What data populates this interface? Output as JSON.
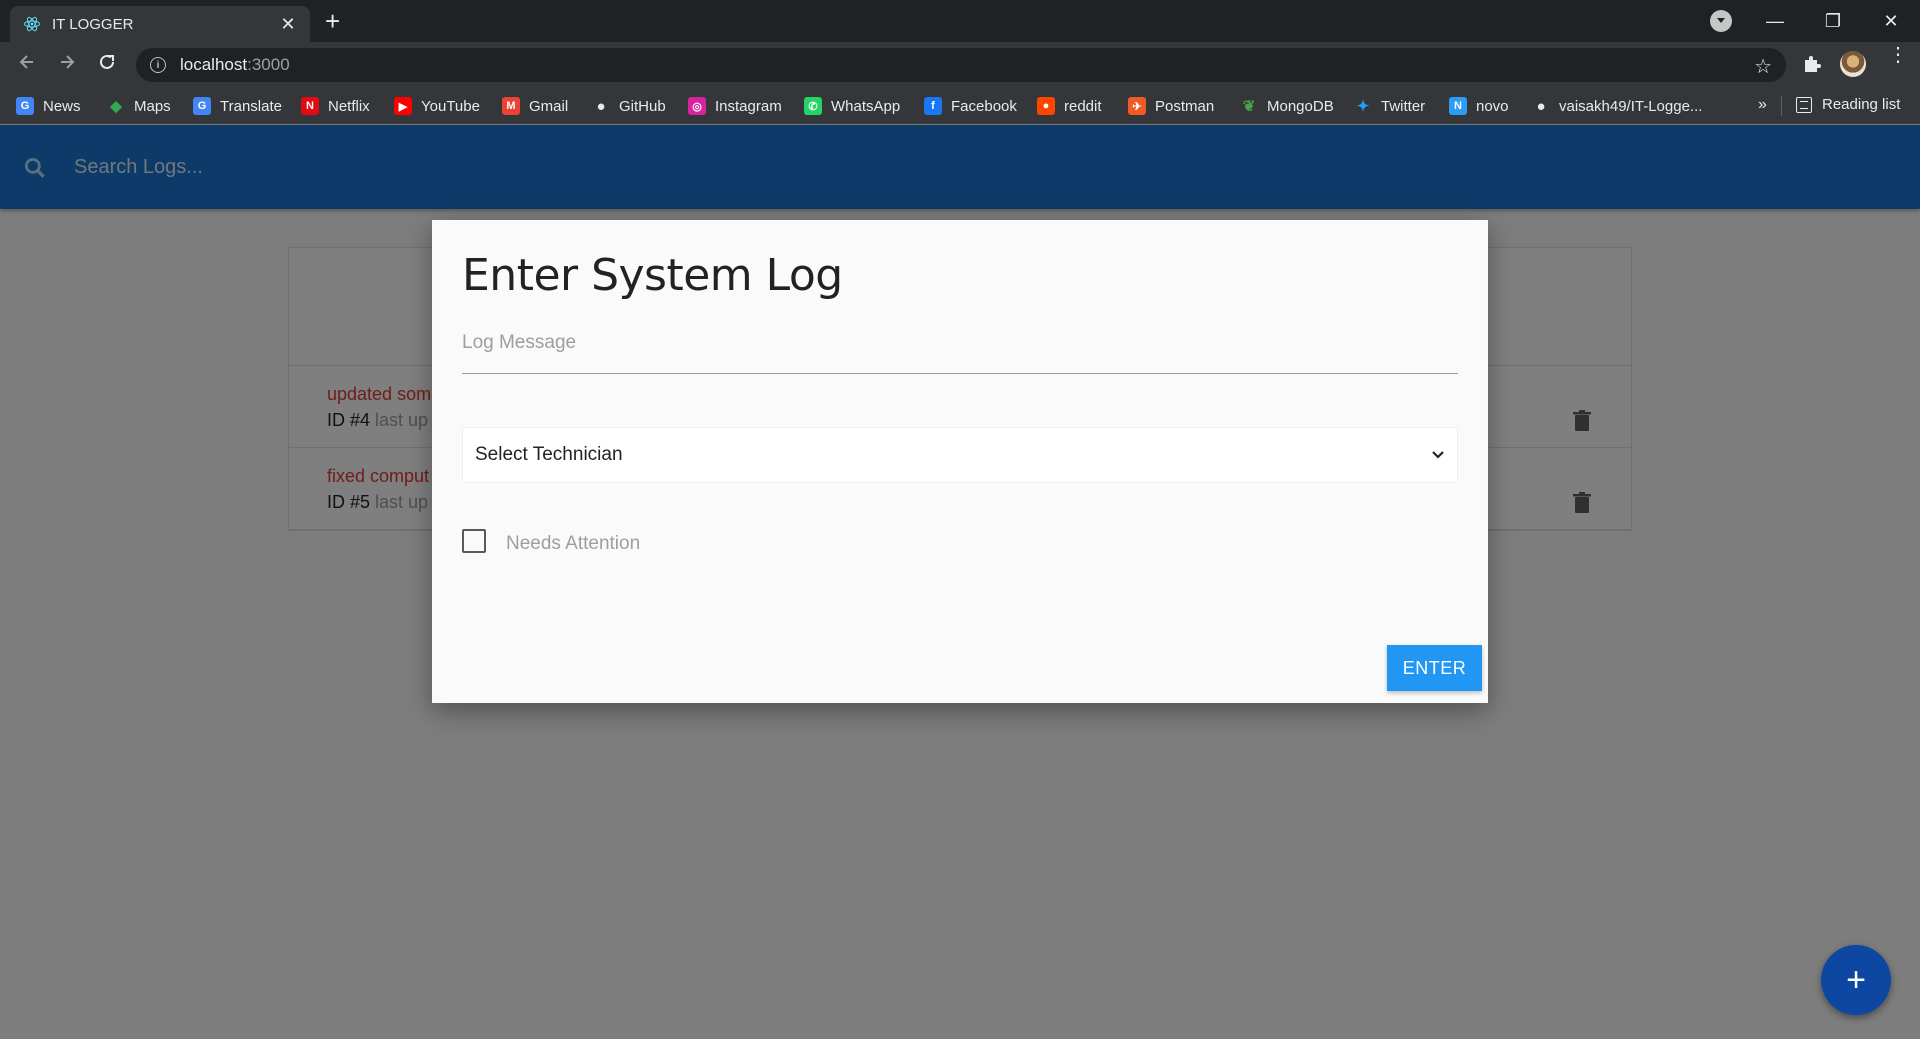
{
  "browser": {
    "tab_title": "IT LOGGER",
    "tab_close": "✕",
    "new_tab": "+",
    "url_host": "localhost",
    "url_port": ":3000",
    "window_controls": [
      "—",
      "❐",
      "✕"
    ],
    "bookmarks": [
      {
        "label": "News",
        "icon": "news-icon",
        "color": "#4285f4"
      },
      {
        "label": "Maps",
        "icon": "maps-icon",
        "color": "#34a853"
      },
      {
        "label": "Translate",
        "icon": "translate-icon",
        "color": "#4285f4"
      },
      {
        "label": "Netflix",
        "icon": "netflix-icon",
        "color": "#e50914"
      },
      {
        "label": "YouTube",
        "icon": "youtube-icon",
        "color": "#ff0000"
      },
      {
        "label": "Gmail",
        "icon": "gmail-icon",
        "color": "#ea4335"
      },
      {
        "label": "GitHub",
        "icon": "github-icon",
        "color": "#e8eaed"
      },
      {
        "label": "Instagram",
        "icon": "instagram-icon",
        "color": "#d6249f"
      },
      {
        "label": "WhatsApp",
        "icon": "whatsapp-icon",
        "color": "#25d366"
      },
      {
        "label": "Facebook",
        "icon": "facebook-icon",
        "color": "#1877f2"
      },
      {
        "label": "reddit",
        "icon": "reddit-icon",
        "color": "#ff4500"
      },
      {
        "label": "Postman",
        "icon": "postman-icon",
        "color": "#ef5b25"
      },
      {
        "label": "MongoDB",
        "icon": "mongodb-icon",
        "color": "#47a248"
      },
      {
        "label": "Twitter",
        "icon": "twitter-icon",
        "color": "#1da1f2"
      },
      {
        "label": "novo",
        "icon": "novo-icon",
        "color": "#2a9df4"
      },
      {
        "label": "vaisakh49/IT-Logge...",
        "icon": "github-icon",
        "color": "#e8eaed"
      }
    ],
    "more": "»",
    "reading_list": "Reading list"
  },
  "app": {
    "search_placeholder": "Search Logs...",
    "accent": "#1976d2",
    "logs": [
      {
        "message": "updated som",
        "id_label": "ID #4",
        "meta": " last up"
      },
      {
        "message": "fixed comput",
        "id_label": "ID #5",
        "meta": " last up"
      }
    ],
    "fab_label": "+"
  },
  "modal": {
    "title": "Enter System Log",
    "message_placeholder": "Log Message",
    "select_value": "Select Technician",
    "checkbox_label": "Needs Attention",
    "enter_label": "ENTER",
    "button_color": "#2196f3"
  }
}
